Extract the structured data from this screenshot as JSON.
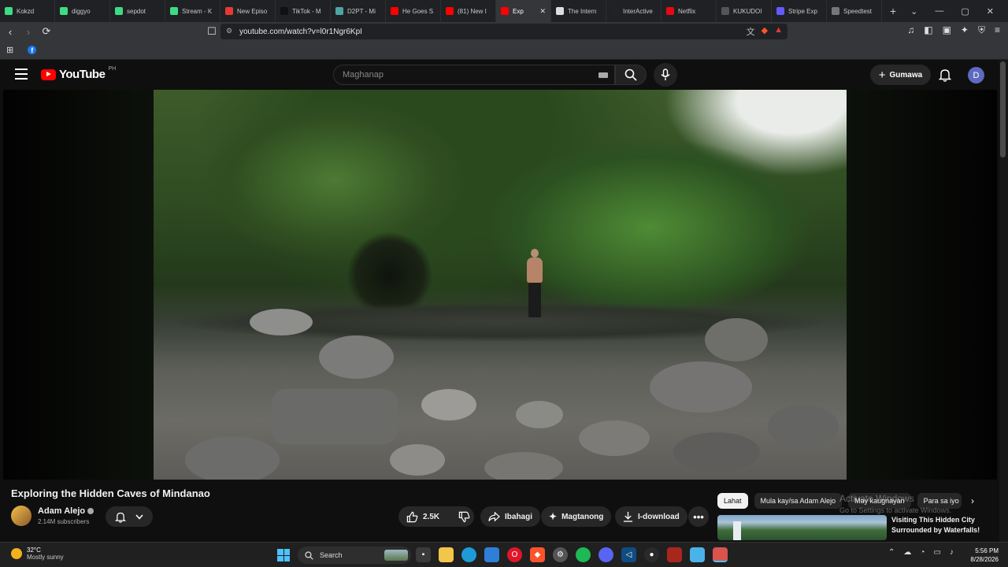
{
  "browser": {
    "tabs": [
      {
        "label": "Kokzd",
        "color": "#3ddc84"
      },
      {
        "label": "diggyo",
        "color": "#3ddc84"
      },
      {
        "label": "sepdot",
        "color": "#3ddc84"
      },
      {
        "label": "Stream - K",
        "color": "#3ddc84"
      },
      {
        "label": "New Episo",
        "color": "#e53935"
      },
      {
        "label": "TikTok - M",
        "color": "#111111"
      },
      {
        "label": "D2PT - Mi",
        "color": "#4fa3a3"
      },
      {
        "label": "He Goes S",
        "color": "#ff0000"
      },
      {
        "label": "(81) New I",
        "color": "#ff0000"
      },
      {
        "label": "Exp",
        "color": "#ff0000"
      },
      {
        "label": "The Intern",
        "color": "#dddddd"
      },
      {
        "label": "InterActive",
        "color": "#222222"
      },
      {
        "label": "Netflix",
        "color": "#e50914"
      },
      {
        "label": "KUKUDOI",
        "color": "#555555"
      },
      {
        "label": "Stripe Exp",
        "color": "#635bff"
      },
      {
        "label": "Speedtest",
        "color": "#777777"
      }
    ],
    "active_tab_index": 9,
    "url": "youtube.com/watch?v=l0r1Ngr6KpI"
  },
  "youtube": {
    "logo_text": "YouTube",
    "region": "PH",
    "search_placeholder": "Maghanap",
    "create_label": "Gumawa",
    "avatar_letter": "D"
  },
  "video": {
    "title": "Exploring the Hidden Caves of Mindanao",
    "channel": "Adam Alejo",
    "subscribers": "2.14M subscribers",
    "likes": "2.5K",
    "share_label": "Ibahagi",
    "ask_label": "Magtanong",
    "download_label": "I-download"
  },
  "chips": [
    {
      "label": "Lahat",
      "active": true
    },
    {
      "label": "Mula kay/sa Adam Alejo",
      "active": false
    },
    {
      "label": "May kaugnayan",
      "active": false
    },
    {
      "label": "Para sa iyo",
      "active": false
    }
  ],
  "recommendation": {
    "title": "Visiting This Hidden City Surrounded by Waterfalls!"
  },
  "watermark": {
    "line1": "Activate Windows",
    "line2": "Go to Settings to activate Windows."
  },
  "taskbar": {
    "temperature": "32°C",
    "weather": "Mostly sunny",
    "search_label": "Search",
    "time": "5:56 PM",
    "date": "8/28/2026"
  }
}
